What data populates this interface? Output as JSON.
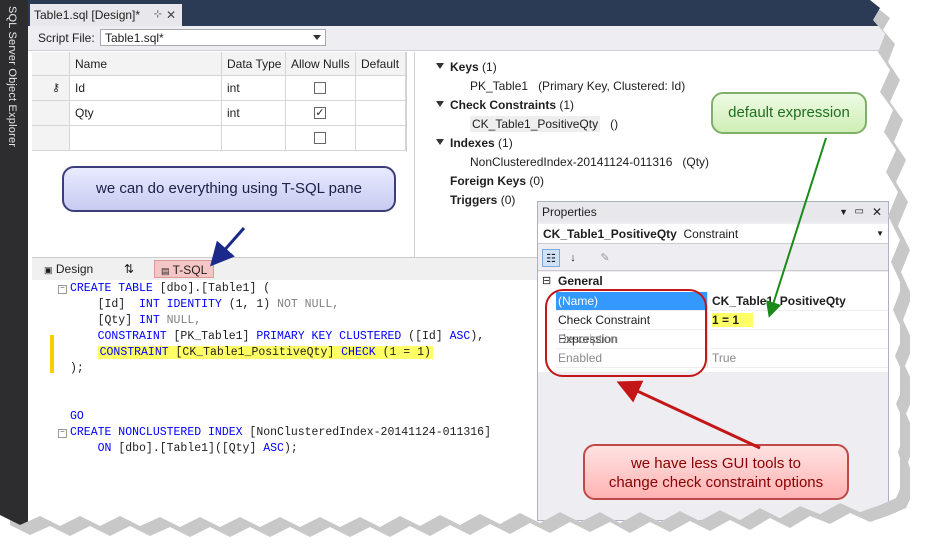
{
  "side_panel": {
    "label": "SQL Server Object Explorer"
  },
  "document_tab": {
    "title": "Table1.sql [Design]*",
    "pin_glyph": "⊹",
    "close_glyph": "✕"
  },
  "script_file": {
    "label": "Script File:",
    "value": "Table1.sql*"
  },
  "grid": {
    "headers": [
      "Name",
      "Data Type",
      "Allow Nulls",
      "Default"
    ],
    "rows": [
      {
        "name": "Id",
        "type": "int",
        "allow_nulls": false,
        "key": true
      },
      {
        "name": "Qty",
        "type": "int",
        "allow_nulls": true,
        "key": false
      },
      {
        "name": "",
        "type": "",
        "allow_nulls": false,
        "key": false
      }
    ]
  },
  "tree": {
    "keys_label": "Keys",
    "keys_count": "(1)",
    "key_item": "PK_Table1",
    "key_desc": "(Primary Key, Clustered: Id)",
    "check_label": "Check Constraints",
    "check_count": "(1)",
    "check_item": "CK_Table1_PositiveQty",
    "check_desc": "()",
    "indexes_label": "Indexes",
    "indexes_count": "(1)",
    "index_item": "NonClusteredIndex-20141124-011316",
    "index_desc": "(Qty)",
    "fk_label": "Foreign Keys",
    "fk_count": "(0)",
    "triggers_label": "Triggers",
    "triggers_count": "(0)"
  },
  "pane_tabs": {
    "design": "Design",
    "swap": "⇅",
    "tsql": "T-SQL"
  },
  "code_lines": {
    "l1_kw": "CREATE TABLE",
    "l1_rest": " [dbo].[Table1] (",
    "l2_a": "    [Id]  ",
    "l2_kw": "INT IDENTITY",
    "l2_b": " (1, 1) ",
    "l2_gr": "NOT NULL,",
    "l3_a": "    [Qty] ",
    "l3_kw": "INT",
    "l3_gr": " NULL,",
    "l4_a": "    ",
    "l4_kw": "CONSTRAINT",
    "l4_b": " [PK_Table1] ",
    "l4_kw2": "PRIMARY KEY CLUSTERED",
    "l4_c": " ([Id] ",
    "l4_kw3": "ASC",
    "l4_d": "),",
    "l5_a": "    ",
    "l5_kw": "CONSTRAINT",
    "l5_b": " [CK_Table1_PositiveQty] ",
    "l5_kw2": "CHECK",
    "l5_c": " (1 = 1)",
    "l6": ");",
    "l7": "GO",
    "l8_kw": "CREATE NONCLUSTERED INDEX",
    "l8_rest": " [NonClusteredIndex-20141124-011316]",
    "l9_a": "    ",
    "l9_kw": "ON",
    "l9_b": " [dbo].[Table1]([Qty] ",
    "l9_kw2": "ASC",
    "l9_c": ");"
  },
  "properties": {
    "title": "Properties",
    "object_name": "CK_Table1_PositiveQty",
    "object_type": "Constraint",
    "category": "General",
    "rows": [
      {
        "name": "(Name)",
        "value": "CK_Table1_PositiveQty"
      },
      {
        "name": "Check Constraint Expression",
        "value": "1 = 1"
      },
      {
        "name": "Description",
        "value": ""
      },
      {
        "name": "Enabled",
        "value": "True"
      }
    ]
  },
  "callouts": {
    "tsql": "we can do everything using T-SQL pane",
    "default": "default expression",
    "gui_line1": "we have less GUI tools to",
    "gui_line2": "change check constraint options"
  },
  "colors": {
    "highlight": "#ffff66",
    "keyword": "#0000ff",
    "callout_red": "#c41616",
    "arrow_green": "#1a8a1a",
    "arrow_navy": "#1b2a8a"
  }
}
